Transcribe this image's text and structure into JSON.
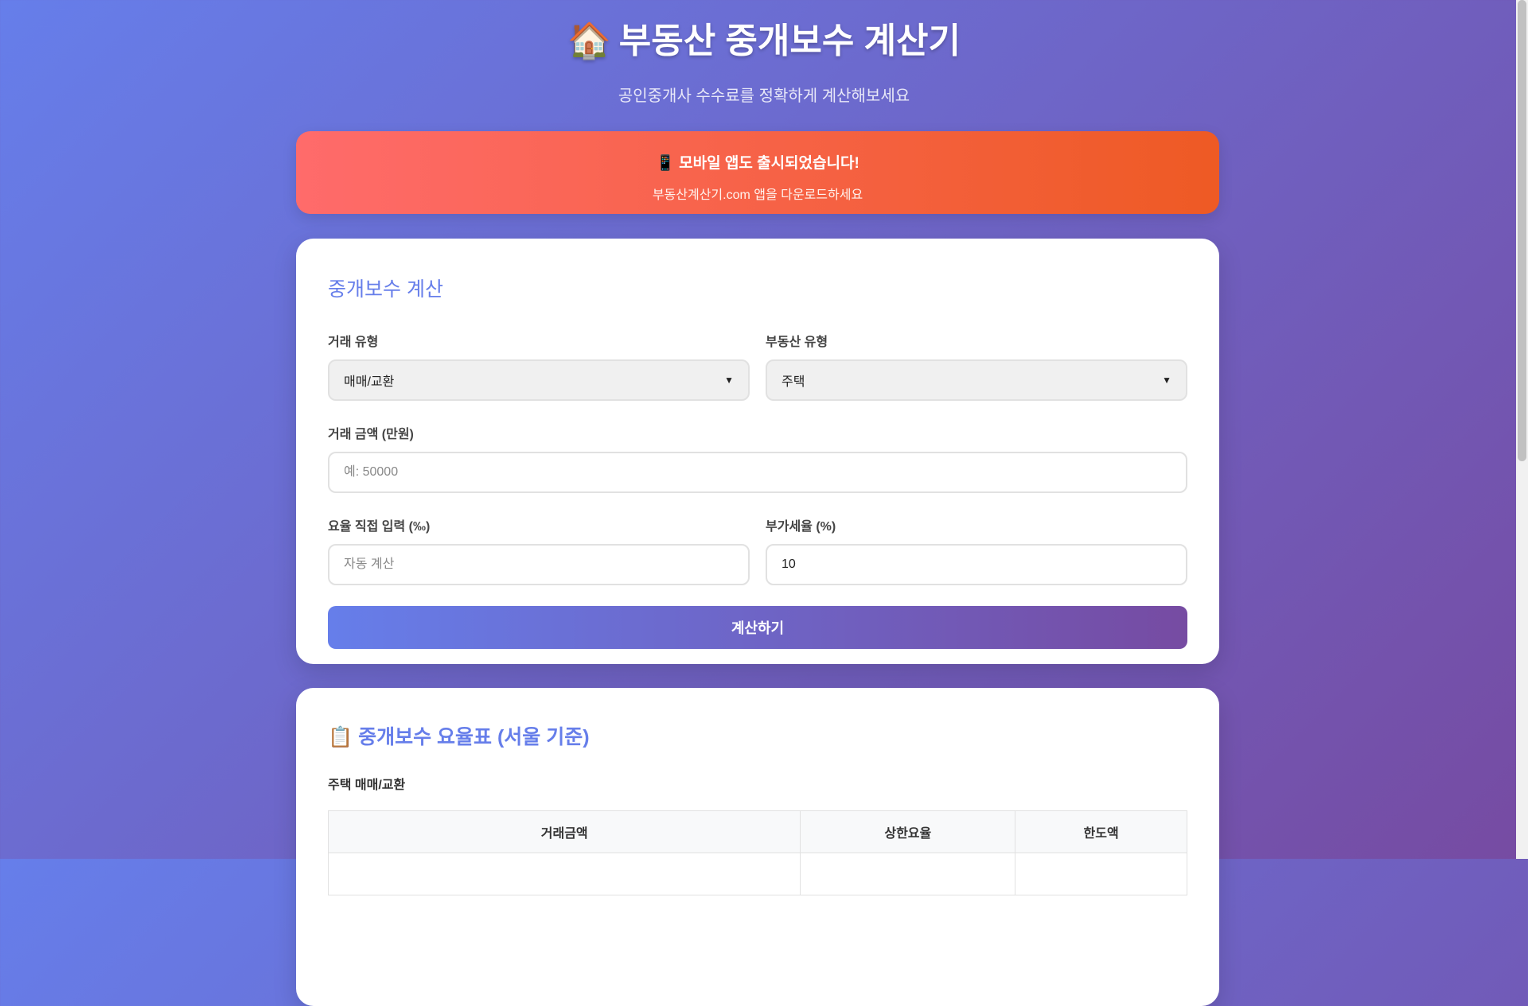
{
  "header": {
    "icon": "house-icon",
    "icon_glyph": "🏠",
    "title": "부동산 중개보수 계산기",
    "subtitle": "공인중개사 수수료를 정확하게 계산해보세요"
  },
  "banner": {
    "icon": "mobile-phone-icon",
    "icon_glyph": "📱",
    "title": "모바일 앱도 출시되었습니다!",
    "text": "부동산계산기.com 앱을 다운로드하세요"
  },
  "calculator": {
    "title": "중개보수 계산",
    "transaction_type": {
      "label": "거래 유형",
      "value": "매매/교환"
    },
    "property_type": {
      "label": "부동산 유형",
      "value": "주택"
    },
    "amount": {
      "label": "거래 금액 (만원)",
      "value": "",
      "placeholder": "예: 50000"
    },
    "rate": {
      "label": "요율 직접 입력 (‰)",
      "value": "",
      "placeholder": "자동 계산"
    },
    "vat": {
      "label": "부가세율 (%)",
      "value": "10"
    },
    "submit_label": "계산하기"
  },
  "rate_table": {
    "icon": "clipboard-icon",
    "icon_glyph": "📋",
    "title": "중개보수 요율표 (서울 기준)",
    "subtitle": "주택 매매/교환",
    "columns": [
      "거래금액",
      "상한요율",
      "한도액"
    ]
  },
  "colors": {
    "accent": "#667eea",
    "accent_dark": "#764ba2",
    "banner_start": "#ff6b6b",
    "banner_end": "#ee5a24"
  }
}
